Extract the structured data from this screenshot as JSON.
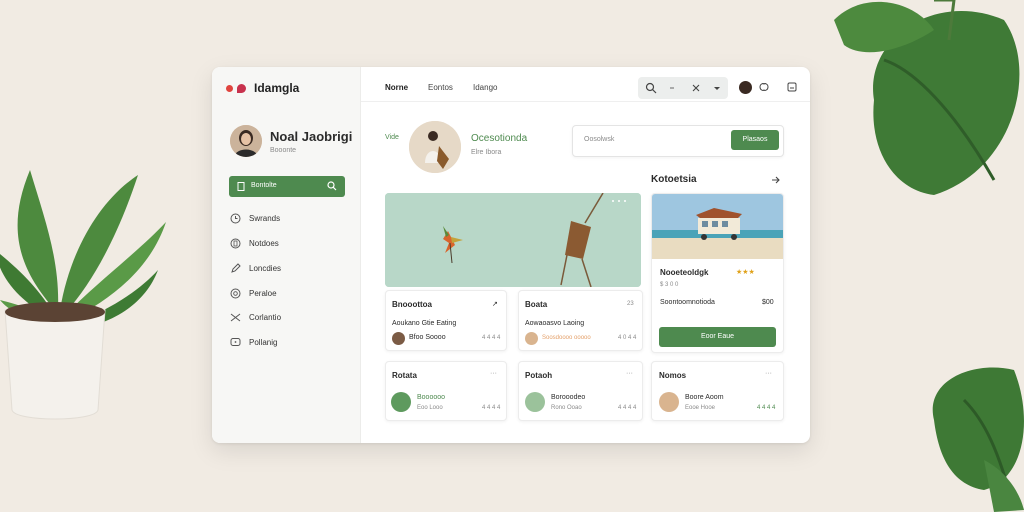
{
  "app": {
    "brand": "Idamgla"
  },
  "profile": {
    "name": "Noal Jaobrigi",
    "subtitle": "Booonte"
  },
  "sidebar": {
    "search_label": "Bontolte",
    "items": [
      {
        "label": "Swrands",
        "icon": "clock-icon"
      },
      {
        "label": "Notdoes",
        "icon": "bookmark-icon"
      },
      {
        "label": "Loncdies",
        "icon": "pen-icon"
      },
      {
        "label": "Peraloe",
        "icon": "at-icon"
      },
      {
        "label": "Corlantio",
        "icon": "shuffle-icon"
      },
      {
        "label": "Pollanig",
        "icon": "chat-icon"
      }
    ]
  },
  "topbar": {
    "tabs": [
      "Norne",
      "Eontos",
      "Idango"
    ]
  },
  "featured": {
    "left_label": "Vide",
    "title": "Ocesotionda",
    "subtitle": "Elre Ibora",
    "search_placeholder": "Oosolwsk",
    "search_button": "Plasaos"
  },
  "section": {
    "title": "Kotoetsia"
  },
  "listing": {
    "title": "Nooeteoldgk",
    "stars": "★★★",
    "subtitle": "$ 3 0 0",
    "detail": "Soontoomnotioda",
    "price": "$00",
    "button": "Eoor Eaue"
  },
  "cards_row1": [
    {
      "title": "Bnooottoa",
      "action": "↗",
      "desc": "Aoukano Gtie Eating",
      "user": "Bfoo Soooo",
      "meta": "4 4 4 4"
    },
    {
      "title": "Boata",
      "action": "23",
      "desc": "Aowaoasvo Laoing",
      "user": "Soosdoooo ooooo",
      "meta": "4 0 4 4"
    }
  ],
  "cards_row2": [
    {
      "title": "Rotata",
      "action": "···",
      "user": "Boooooo",
      "meta": "Eoo Looo",
      "count": "4 4 4 4"
    },
    {
      "title": "Potaoh",
      "action": "···",
      "user": "Borooodeo",
      "meta": "Rono Ooao",
      "count": "4 4 4 4"
    },
    {
      "title": "Nomos",
      "action": "···",
      "user": "Boore Aoom",
      "meta": "Eooe Hooe",
      "count": "4 4 4 4"
    }
  ],
  "colors": {
    "accent": "#4e8a4f",
    "hero_bg": "#b8d7c8",
    "background": "#f1ebe3"
  }
}
